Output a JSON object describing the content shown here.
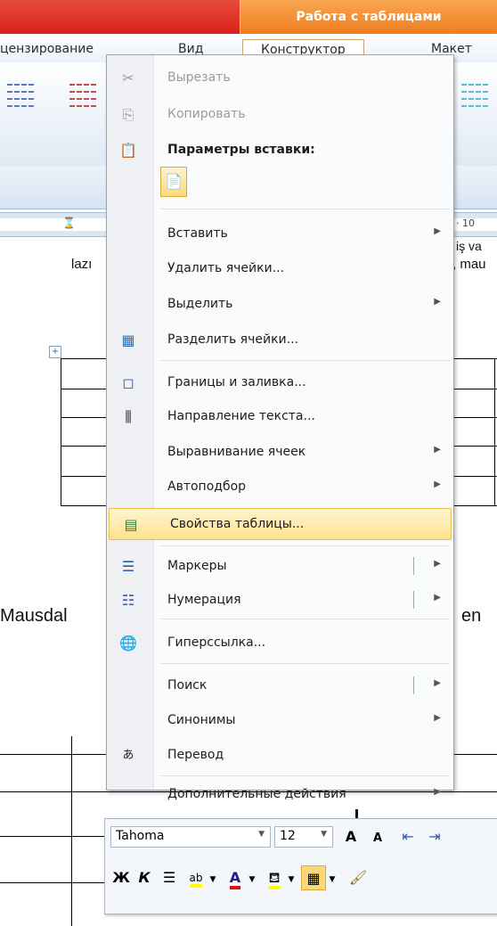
{
  "ribbon": {
    "context_title": "Работа с таблицами",
    "tabs": [
      "цензирование",
      "Вид",
      "Конструктор",
      "Макет"
    ],
    "active_tab": "Конструктор",
    "ruler_number": "· 10"
  },
  "document": {
    "fragments": [
      "lazı",
      ", mau",
      "iş va",
      "Mausdal",
      "en"
    ]
  },
  "menu": {
    "items": [
      {
        "label": "Вырезать",
        "icon": "scissors-icon",
        "disabled": true
      },
      {
        "label": "Копировать",
        "icon": "copy-icon",
        "disabled": true
      },
      {
        "label": "Параметры вставки:",
        "icon": "paste-icon",
        "header": true
      },
      {
        "label": "Вставить",
        "submenu": true
      },
      {
        "label": "Удалить ячейки..."
      },
      {
        "label": "Выделить",
        "submenu": true
      },
      {
        "label": "Разделить ячейки...",
        "icon": "split-cells-icon"
      },
      {
        "label": "Границы и заливка...",
        "icon": "borders-icon"
      },
      {
        "label": "Направление текста...",
        "icon": "text-direction-icon"
      },
      {
        "label": "Выравнивание ячеек",
        "submenu": true
      },
      {
        "label": "Автоподбор",
        "submenu": true
      },
      {
        "label": "Свойства таблицы...",
        "icon": "table-properties-icon",
        "highlighted": true
      },
      {
        "label": "Маркеры",
        "icon": "bullets-icon",
        "split": true
      },
      {
        "label": "Нумерация",
        "icon": "numbering-icon",
        "split": true
      },
      {
        "label": "Гиперссылка...",
        "icon": "hyperlink-icon"
      },
      {
        "label": "Поиск",
        "split": true
      },
      {
        "label": "Синонимы",
        "submenu": true
      },
      {
        "label": "Перевод",
        "icon": "translate-icon"
      },
      {
        "label": "Дополнительные действия",
        "submenu": true
      }
    ]
  },
  "mini_toolbar": {
    "font": "Tahoma",
    "size": "12",
    "bold": "Ж",
    "italic": "К",
    "grow_font": "A",
    "shrink_font": "A",
    "highlight_text": "ab",
    "font_color_letter": "A",
    "colors": {
      "font_color": "#e01010",
      "highlight": "#ffff00",
      "selected_button": "#fbd97a"
    }
  }
}
